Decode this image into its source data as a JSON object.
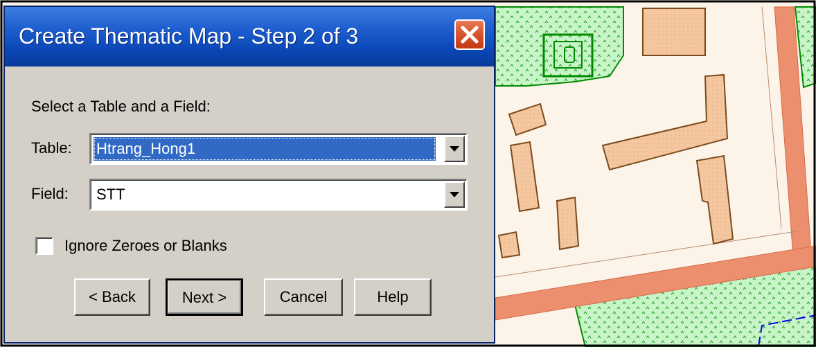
{
  "dialog": {
    "title": "Create Thematic Map - Step 2 of 3",
    "instruction": "Select a Table and a Field:",
    "table_label": "Table:",
    "table_value": "Htrang_Hong1",
    "field_label": "Field:",
    "field_value": "STT",
    "checkbox_label": "Ignore Zeroes or Blanks",
    "checkbox_checked": false,
    "buttons": {
      "back": "< Back",
      "next": "Next >",
      "cancel": "Cancel",
      "help": "Help"
    }
  },
  "colors": {
    "titlebar": "#0b48b8",
    "dialog_bg": "#d4d0c8",
    "selection": "#316ac5",
    "close_button": "#d6532b",
    "map_background": "#fdf4e9",
    "building_fill": "#f5c7a0",
    "building_stroke": "#7a4a1c",
    "road": "#ec8f6e",
    "green_area": "#c8f5c8",
    "green_stroke": "#008a00",
    "blue_line": "#0000ee"
  }
}
